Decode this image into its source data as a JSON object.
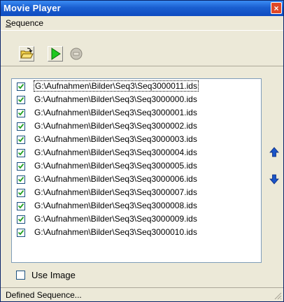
{
  "window": {
    "title": "Movie Player",
    "close_label": "×"
  },
  "menu": {
    "sequence_label_first": "S",
    "sequence_label_rest": "equence"
  },
  "toolbar": {
    "buttons": [
      {
        "name": "open-folder-icon"
      },
      {
        "name": "play-icon"
      },
      {
        "name": "stop-icon",
        "disabled": true
      }
    ]
  },
  "sequence_list": {
    "items": [
      {
        "path": "G:\\Aufnahmen\\Bilder\\Seq3\\Seq3000011.ids",
        "checked": true
      },
      {
        "path": "G:\\Aufnahmen\\Bilder\\Seq3\\Seq3000000.ids",
        "checked": true
      },
      {
        "path": "G:\\Aufnahmen\\Bilder\\Seq3\\Seq3000001.ids",
        "checked": true
      },
      {
        "path": "G:\\Aufnahmen\\Bilder\\Seq3\\Seq3000002.ids",
        "checked": true
      },
      {
        "path": "G:\\Aufnahmen\\Bilder\\Seq3\\Seq3000003.ids",
        "checked": true
      },
      {
        "path": "G:\\Aufnahmen\\Bilder\\Seq3\\Seq3000004.ids",
        "checked": true
      },
      {
        "path": "G:\\Aufnahmen\\Bilder\\Seq3\\Seq3000005.ids",
        "checked": true
      },
      {
        "path": "G:\\Aufnahmen\\Bilder\\Seq3\\Seq3000006.ids",
        "checked": true
      },
      {
        "path": "G:\\Aufnahmen\\Bilder\\Seq3\\Seq3000007.ids",
        "checked": true
      },
      {
        "path": "G:\\Aufnahmen\\Bilder\\Seq3\\Seq3000008.ids",
        "checked": true
      },
      {
        "path": "G:\\Aufnahmen\\Bilder\\Seq3\\Seq3000009.ids",
        "checked": true
      },
      {
        "path": "G:\\Aufnahmen\\Bilder\\Seq3\\Seq3000010.ids",
        "checked": true
      }
    ]
  },
  "use_image": {
    "label": "Use Image",
    "checked": false
  },
  "status": {
    "text": "Defined Sequence..."
  },
  "colors": {
    "title_bar": "#1a5fd0",
    "close_button": "#e04828",
    "arrow_blue": "#1a54c8",
    "play_green": "#1ec81e"
  }
}
